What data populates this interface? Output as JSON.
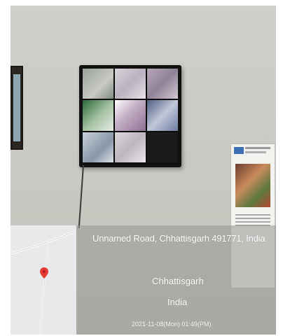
{
  "overlay": {
    "address": "Unnamed Road, Chhattisgarh 491771, India",
    "state": "Chhattisgarh",
    "country": "India",
    "datetime": "2021-11-08(Mon) 01:49(PM)"
  },
  "map": {
    "pin_icon": "map-pin-icon",
    "pin_color": "#e53935"
  }
}
